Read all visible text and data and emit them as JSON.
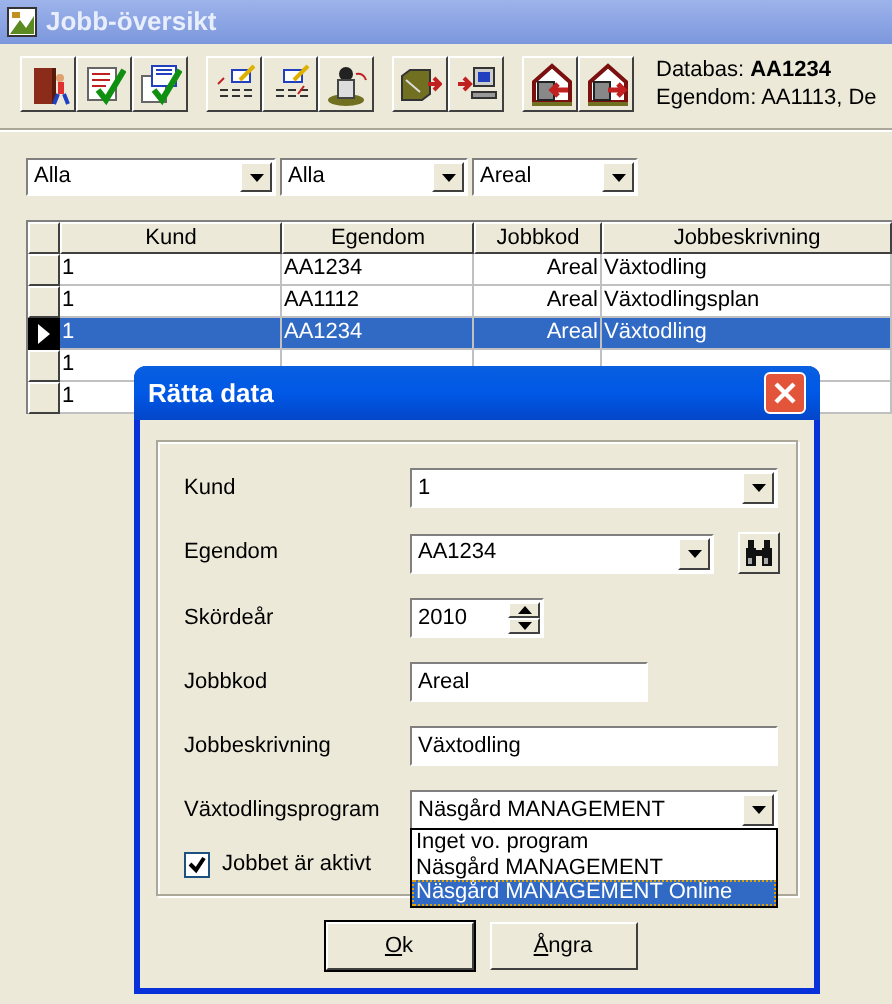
{
  "window": {
    "title": "Jobb-översikt"
  },
  "info": {
    "database_label": "Databas:",
    "database": "AA1234",
    "property_line": "Egendom: AA1113, De"
  },
  "filters": [
    {
      "value": "Alla"
    },
    {
      "value": "Alla"
    },
    {
      "value": "Areal"
    }
  ],
  "table": {
    "columns": [
      "Kund",
      "Egendom",
      "Jobbkod",
      "Jobbeskrivning"
    ],
    "rows": [
      {
        "cells": [
          "1",
          "AA1234",
          "Areal",
          "Växtodling"
        ],
        "selected": false
      },
      {
        "cells": [
          "1",
          "AA1112",
          "Areal",
          "Växtodlingsplan"
        ],
        "selected": false
      },
      {
        "cells": [
          "1",
          "AA1234",
          "Areal",
          "Växtodling"
        ],
        "selected": true
      },
      {
        "cells": [
          "1"
        ],
        "selected": false
      },
      {
        "cells": [
          "1"
        ],
        "selected": false
      }
    ]
  },
  "dialog": {
    "title": "Rätta data",
    "fields": [
      {
        "kind": "combo",
        "label": "Kund",
        "value": "1"
      },
      {
        "kind": "combo_search",
        "label": "Egendom",
        "value": "AA1234"
      },
      {
        "kind": "spinner",
        "label": "Skördeår",
        "value": "2010"
      },
      {
        "kind": "text",
        "label": "Jobbkod",
        "value": "Areal"
      },
      {
        "kind": "text",
        "label": "Jobbeskrivning",
        "value": "Växtodling"
      },
      {
        "kind": "combo",
        "label": "Växtodlingsprogram",
        "value": "Näsgård MANAGEMENT"
      }
    ],
    "open_list": [
      {
        "label": "Inget vo. program",
        "selected": false
      },
      {
        "label": "Näsgård MANAGEMENT",
        "selected": false
      },
      {
        "label": "Näsgård MANAGEMENT Online",
        "selected": true
      }
    ],
    "active_checkbox": {
      "label": "Jobbet är aktivt",
      "checked": true
    },
    "buttons": [
      "Ok",
      "Ångra"
    ]
  }
}
